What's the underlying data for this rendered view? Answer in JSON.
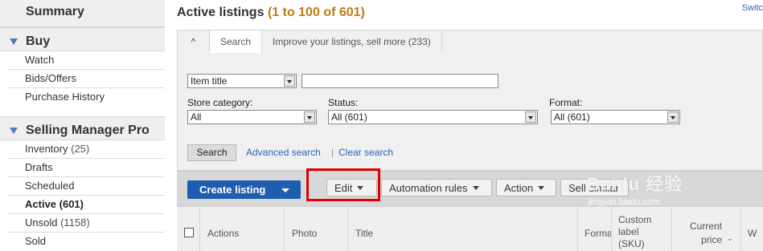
{
  "sidebar": {
    "summary": "Summary",
    "buy": {
      "label": "Buy",
      "items": [
        {
          "label": "Watch"
        },
        {
          "label": "Bids/Offers"
        },
        {
          "label": "Purchase History"
        }
      ]
    },
    "selling": {
      "label": "Selling Manager Pro",
      "items": [
        {
          "label": "Inventory",
          "count": "(25)"
        },
        {
          "label": "Drafts",
          "count": ""
        },
        {
          "label": "Scheduled",
          "count": ""
        },
        {
          "label": "Active (601)",
          "count": ""
        },
        {
          "label": "Unsold",
          "count": "(1158)"
        },
        {
          "label": "Sold",
          "count": ""
        }
      ]
    }
  },
  "header": {
    "title": "Active listings",
    "range": "(1 to 100 of 601)",
    "switch_link": "Switc"
  },
  "search_panel": {
    "toggle": "^",
    "tabs": [
      {
        "label": "Search"
      },
      {
        "label": "Improve your listings, sell more (233)"
      }
    ],
    "field_select": "Item title",
    "store_category": {
      "label": "Store category:",
      "value": "All"
    },
    "status": {
      "label": "Status:",
      "value": "All (601)"
    },
    "format": {
      "label": "Format:",
      "value": "All (601)"
    },
    "search_button": "Search",
    "advanced_search": "Advanced search",
    "separator": "|",
    "clear_search": "Clear search"
  },
  "toolbar": {
    "create_listing": "Create listing",
    "edit": "Edit",
    "automation_rules": "Automation rules",
    "action": "Action",
    "sell_similar": "Sell similar"
  },
  "table": {
    "headers": {
      "actions": "Actions",
      "photo": "Photo",
      "title": "Title",
      "format": "Forma",
      "custom_label_1": "Custom",
      "custom_label_2": "label",
      "custom_label_3": "(SKU)",
      "current_price_1": "Current",
      "current_price_2": "price",
      "last": "W"
    }
  },
  "watermark": {
    "text": "Baidu 经验",
    "sub": "jingyan.baidu.com"
  },
  "colors": {
    "accent_blue": "#1f5dae",
    "range_orange": "#c07a12",
    "link_blue": "#2a64b4",
    "highlight_red": "#e00000"
  }
}
